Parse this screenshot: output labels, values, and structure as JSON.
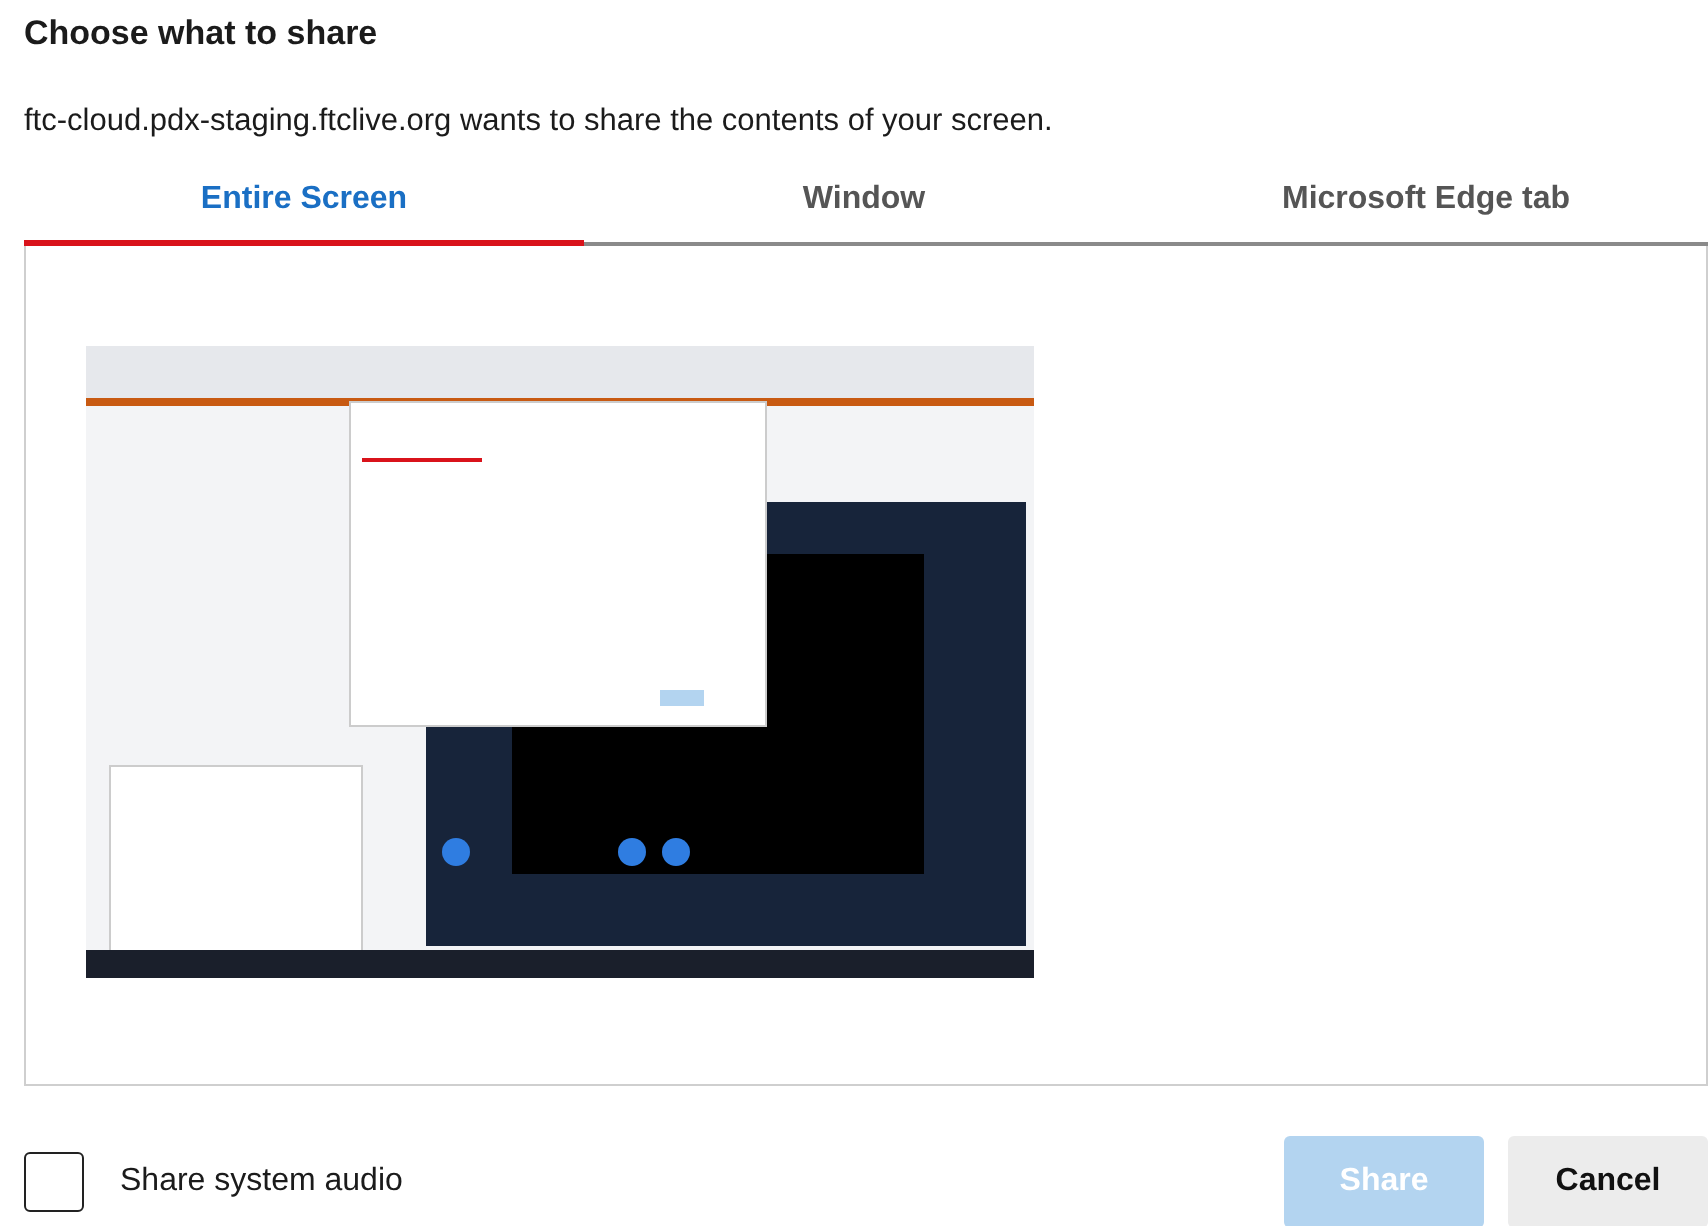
{
  "dialog": {
    "title": "Choose what to share",
    "description": "ftc-cloud.pdx-staging.ftclive.org wants to share the contents of your screen."
  },
  "tabs": [
    {
      "label": "Entire Screen",
      "selected": true
    },
    {
      "label": "Window",
      "selected": false
    },
    {
      "label": "Microsoft Edge tab",
      "selected": false
    }
  ],
  "audio_checkbox": {
    "label": "Share system audio",
    "checked": false
  },
  "buttons": [
    {
      "label": "Share",
      "kind": "primary",
      "disabled": true
    },
    {
      "label": "Cancel",
      "kind": "secondary",
      "disabled": false
    }
  ]
}
